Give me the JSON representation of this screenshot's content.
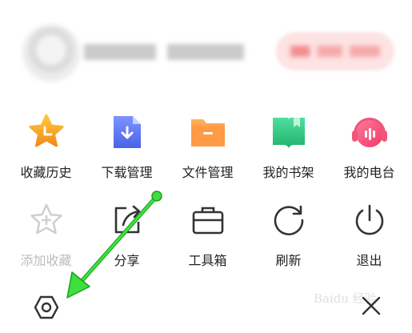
{
  "account": {
    "blurred": true
  },
  "menu": {
    "row1": [
      {
        "label": "收藏历史",
        "icon": "star-clock-icon"
      },
      {
        "label": "下载管理",
        "icon": "download-file-icon"
      },
      {
        "label": "文件管理",
        "icon": "folder-icon"
      },
      {
        "label": "我的书架",
        "icon": "book-icon"
      },
      {
        "label": "我的电台",
        "icon": "headphones-icon"
      }
    ],
    "row2": [
      {
        "label": "添加收藏",
        "icon": "add-star-icon",
        "disabled": true
      },
      {
        "label": "分享",
        "icon": "share-icon"
      },
      {
        "label": "工具箱",
        "icon": "toolbox-icon"
      },
      {
        "label": "刷新",
        "icon": "refresh-icon"
      },
      {
        "label": "退出",
        "icon": "power-icon"
      }
    ]
  },
  "bottom": {
    "settings_icon": "settings-hexagon-icon",
    "close_icon": "close-icon",
    "watermark": "Baidu 经验"
  },
  "colors": {
    "annotation_arrow": "#33dd33",
    "accent_orange": "#f5a623",
    "accent_blue": "#5b7cf7",
    "accent_green": "#33c481",
    "accent_pink": "#f2557a"
  }
}
